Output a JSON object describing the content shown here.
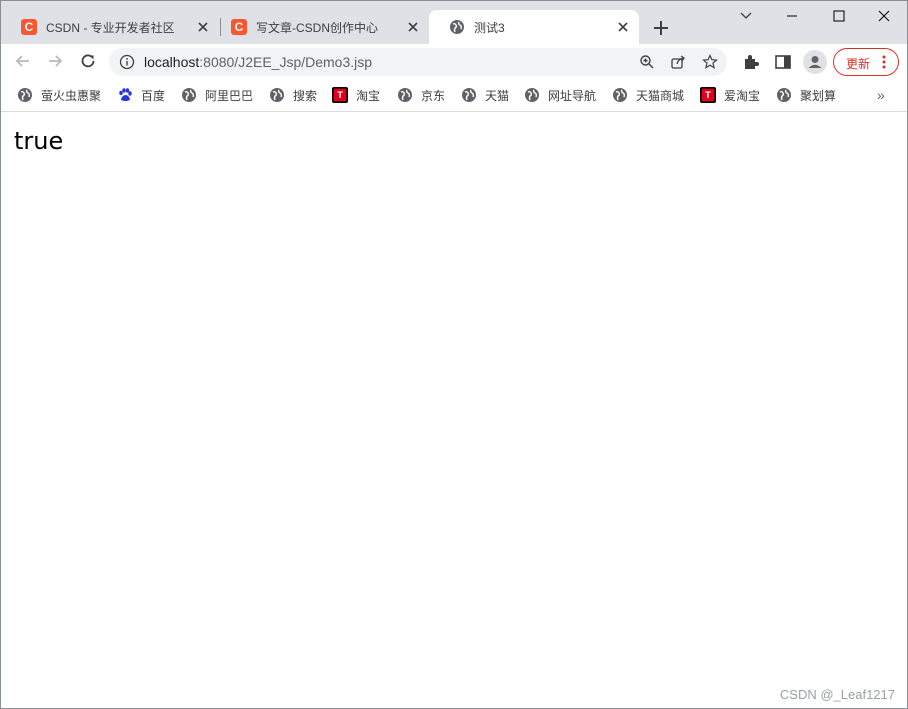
{
  "tabs": [
    {
      "title": "CSDN - 专业开发者社区",
      "favicon": "csdn-icon",
      "active": false
    },
    {
      "title": "写文章-CSDN创作中心",
      "favicon": "csdn-icon",
      "active": false
    },
    {
      "title": "测试3",
      "favicon": "globe-icon",
      "active": true
    }
  ],
  "omnibox": {
    "host": "localhost",
    "path": ":8080/J2EE_Jsp/Demo3.jsp"
  },
  "toolbar": {
    "update_label": "更新"
  },
  "bookmarks": [
    {
      "label": "萤火虫惠聚",
      "icon": "globe-icon"
    },
    {
      "label": "百度",
      "icon": "baidu-paw-icon"
    },
    {
      "label": "阿里巴巴",
      "icon": "globe-icon"
    },
    {
      "label": "搜索",
      "icon": "globe-icon"
    },
    {
      "label": "淘宝",
      "icon": "tmall-icon"
    },
    {
      "label": "京东",
      "icon": "globe-icon"
    },
    {
      "label": "天猫",
      "icon": "globe-icon"
    },
    {
      "label": "网址导航",
      "icon": "globe-icon"
    },
    {
      "label": "天猫商城",
      "icon": "globe-icon"
    },
    {
      "label": "爱淘宝",
      "icon": "tmall-icon"
    },
    {
      "label": "聚划算",
      "icon": "globe-icon"
    }
  ],
  "page": {
    "result_text": "true",
    "watermark": "CSDN @_Leaf1217"
  },
  "colors": {
    "accent_red": "#d93025",
    "csdn_orange": "#fc5531",
    "tabstrip_bg": "#dee1e6"
  }
}
